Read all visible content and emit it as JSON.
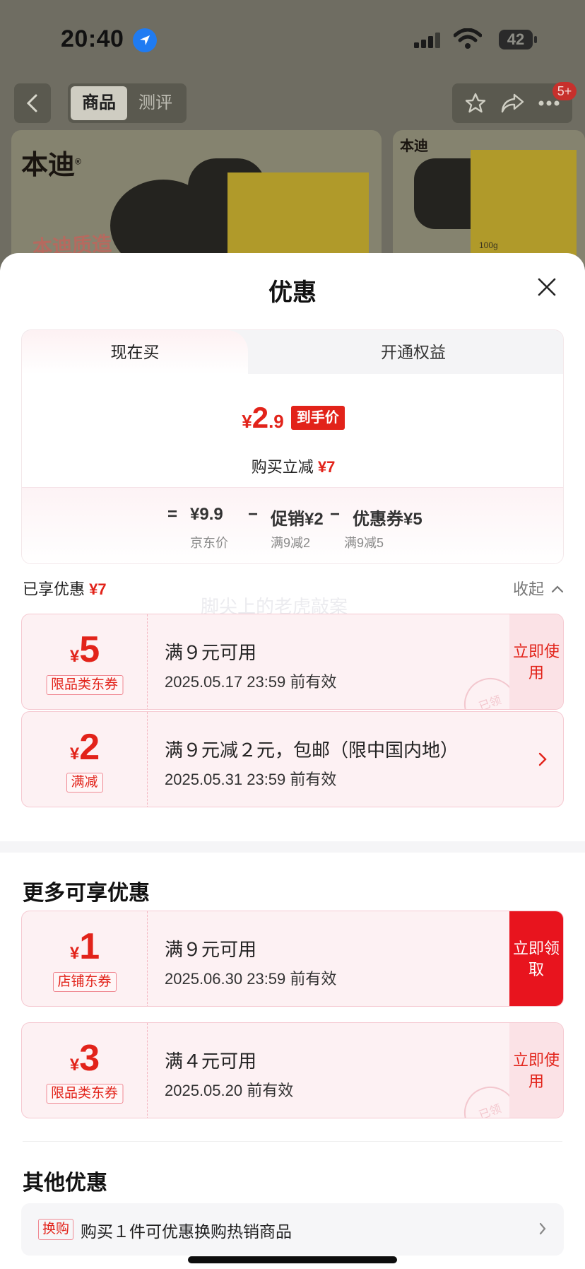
{
  "status_bar": {
    "time": "20:40",
    "battery": "42"
  },
  "nav": {
    "tab_product": "商品",
    "tab_review": "测评",
    "badge": "5+"
  },
  "product": {
    "brand": "本迪",
    "brand_mark": "®",
    "tagline": "本迪质造",
    "pack_size": "100g"
  },
  "sheet": {
    "title": "优惠",
    "tab_now": "现在买",
    "tab_rights": "开通权益",
    "price_yen": "¥",
    "price_int": "2",
    "price_dec": ".9",
    "price_tag": "到手价",
    "instant_cut_label": "购买立减",
    "instant_cut_value": "¥7",
    "breakdown": {
      "eq": "=",
      "jd_price": "¥9.9",
      "minus1": "−",
      "promo": "促销¥2",
      "minus2": "−",
      "coupon": "优惠券¥5",
      "jd_price_label": "京东价",
      "promo_label": "满9减2",
      "coupon_label": "满9减5"
    },
    "enjoyed_label": "已享优惠",
    "enjoyed_value": "¥7",
    "collapse_label": "收起",
    "watermark": "脚尖上的老虎敲案"
  },
  "enjoyed_coupons": [
    {
      "yen": "¥",
      "amount": "5",
      "tag": "限品类东券",
      "title": "满９元可用",
      "date": "2025.05.17 23:59 前有效",
      "action": "立即使用",
      "stamp": "已领"
    },
    {
      "yen": "¥",
      "amount": "2",
      "tag": "满减",
      "title": "满９元减２元，包邮（限中国内地）",
      "date": "2025.05.31 23:59 前有效"
    }
  ],
  "more_section_title": "更多可享优惠",
  "more_coupons": [
    {
      "yen": "¥",
      "amount": "1",
      "tag": "店铺东券",
      "title": "满９元可用",
      "date": "2025.06.30 23:59 前有效",
      "action": "立即领取"
    },
    {
      "yen": "¥",
      "amount": "3",
      "tag": "限品类东券",
      "title": "满４元可用",
      "date": "2025.05.20 前有效",
      "action": "立即使用",
      "stamp": "已领"
    }
  ],
  "other_section_title": "其他优惠",
  "other": {
    "tag": "换购",
    "text": "购买１件可优惠换购热销商品"
  },
  "colors": {
    "accent_red": "#e2231a",
    "coupon_bg": "#fdf1f3",
    "dim_bg": "#6f6d62"
  }
}
